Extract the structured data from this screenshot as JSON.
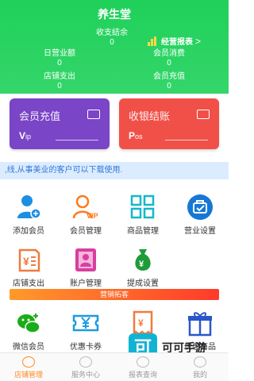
{
  "header": {
    "title": "养生堂",
    "stats": {
      "cashier_label": "收支结余",
      "cashier_value": "0",
      "daily_label": "日营业额",
      "daily_value": "0",
      "store_label": "店铺支出",
      "store_value": "0",
      "consume_label": "会员消费",
      "consume_value": "0",
      "recharge_label": "会员充值",
      "recharge_value": "0"
    },
    "report_label": "经营报表",
    "report_chevron": ">"
  },
  "cards": [
    {
      "name": "vip",
      "label": "会员充值",
      "big": "V",
      "small": "ip"
    },
    {
      "name": "pos",
      "label": "收银结账",
      "big": "P",
      "small": "os"
    }
  ],
  "notice": ",线,从事美业的客户可以下载使用.",
  "grid": [
    {
      "label": "添加会员",
      "icon": "add-user-icon"
    },
    {
      "label": "会员管理",
      "icon": "vip-user-icon"
    },
    {
      "label": "商品管理",
      "icon": "product-grid-icon"
    },
    {
      "label": "营业设置",
      "icon": "settings-bag-icon"
    },
    {
      "label": "店铺支出",
      "icon": "expense-icon"
    },
    {
      "label": "账户管理",
      "icon": "account-icon"
    },
    {
      "label": "提成设置",
      "icon": "money-bag-icon"
    }
  ],
  "marketing": {
    "title": "营销拓客",
    "items": [
      {
        "label": "微信会员",
        "icon": "wechat-icon"
      },
      {
        "label": "优惠卡券",
        "icon": "coupon-icon"
      },
      {
        "label": "定",
        "icon": "receipt-icon"
      },
      {
        "label": "优惠商品",
        "icon": "gift-icon"
      }
    ]
  },
  "tabs": [
    {
      "label": "店铺管理",
      "active": true
    },
    {
      "label": "服务中心",
      "active": false
    },
    {
      "label": "报表查询",
      "active": false
    },
    {
      "label": "我的",
      "active": false
    }
  ],
  "watermark": {
    "logo": "可",
    "text": "可可手游"
  },
  "colors": {
    "header": "#1fd05a",
    "vip_card": "#7a45c6",
    "pos_card": "#f15049",
    "notice_bg": "#dcecff",
    "tab_active": "#ff8a20"
  }
}
